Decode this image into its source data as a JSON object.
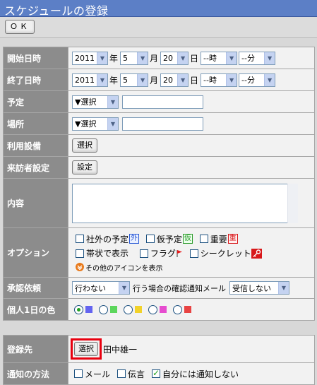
{
  "window": {
    "title": "スケジュールの登録"
  },
  "toolbar": {
    "ok_label": "ＯＫ"
  },
  "colors": {
    "title_bar": "#5c7fc6",
    "label_bg": "#8c8c8c",
    "highlight": "#e8000f"
  },
  "form": {
    "start": {
      "label": "開始日時",
      "year": "2011",
      "year_unit": "年",
      "month": "5",
      "month_unit": "月",
      "day": "20",
      "day_unit": "日",
      "hour": "--時",
      "minute": "--分"
    },
    "end": {
      "label": "終了日時",
      "year": "2011",
      "year_unit": "年",
      "month": "5",
      "month_unit": "月",
      "day": "20",
      "day_unit": "日",
      "hour": "--時",
      "minute": "--分"
    },
    "plan": {
      "label": "予定",
      "select": "▼選択",
      "text": ""
    },
    "place": {
      "label": "場所",
      "select": "▼選択",
      "text": ""
    },
    "equipment": {
      "label": "利用設備",
      "button": "選択"
    },
    "visitor": {
      "label": "来訪者設定",
      "button": "設定"
    },
    "content": {
      "label": "内容",
      "value": ""
    },
    "options": {
      "label": "オプション",
      "items": [
        {
          "label": "社外の予定",
          "icon_text": "外",
          "icon_color": "#2a5ad6",
          "checked": false
        },
        {
          "label": "仮予定",
          "icon_text": "仮",
          "icon_color": "#2a9a2a",
          "checked": false
        },
        {
          "label": "重要",
          "icon_text": "重",
          "icon_color": "#d8181a",
          "checked": false
        },
        {
          "label": "帯状で表示",
          "checked": false
        },
        {
          "label": "フラグ",
          "icon_text": "flag-icon",
          "checked": false
        },
        {
          "label": "シークレット",
          "icon_text": "key-icon",
          "checked": false
        }
      ],
      "more_link": "その他のアイコンを表示"
    },
    "approval": {
      "label": "承認依頼",
      "select": "行わない",
      "notify_label": "行う場合の確認通知メール",
      "notify_select": "受信しない"
    },
    "color": {
      "label": "個人1日の色",
      "swatches": [
        "#6464f0",
        "#5cd65c",
        "#f2d22a",
        "#e64ccf",
        "#e84343"
      ],
      "selected": 0
    },
    "registrant": {
      "label": "登録先",
      "button": "選択",
      "name": "田中雄一"
    },
    "notify": {
      "label": "通知の方法",
      "items": [
        {
          "label": "メール",
          "checked": false
        },
        {
          "label": "伝言",
          "checked": false
        },
        {
          "label": "自分には通知しない",
          "checked": true
        }
      ]
    }
  }
}
